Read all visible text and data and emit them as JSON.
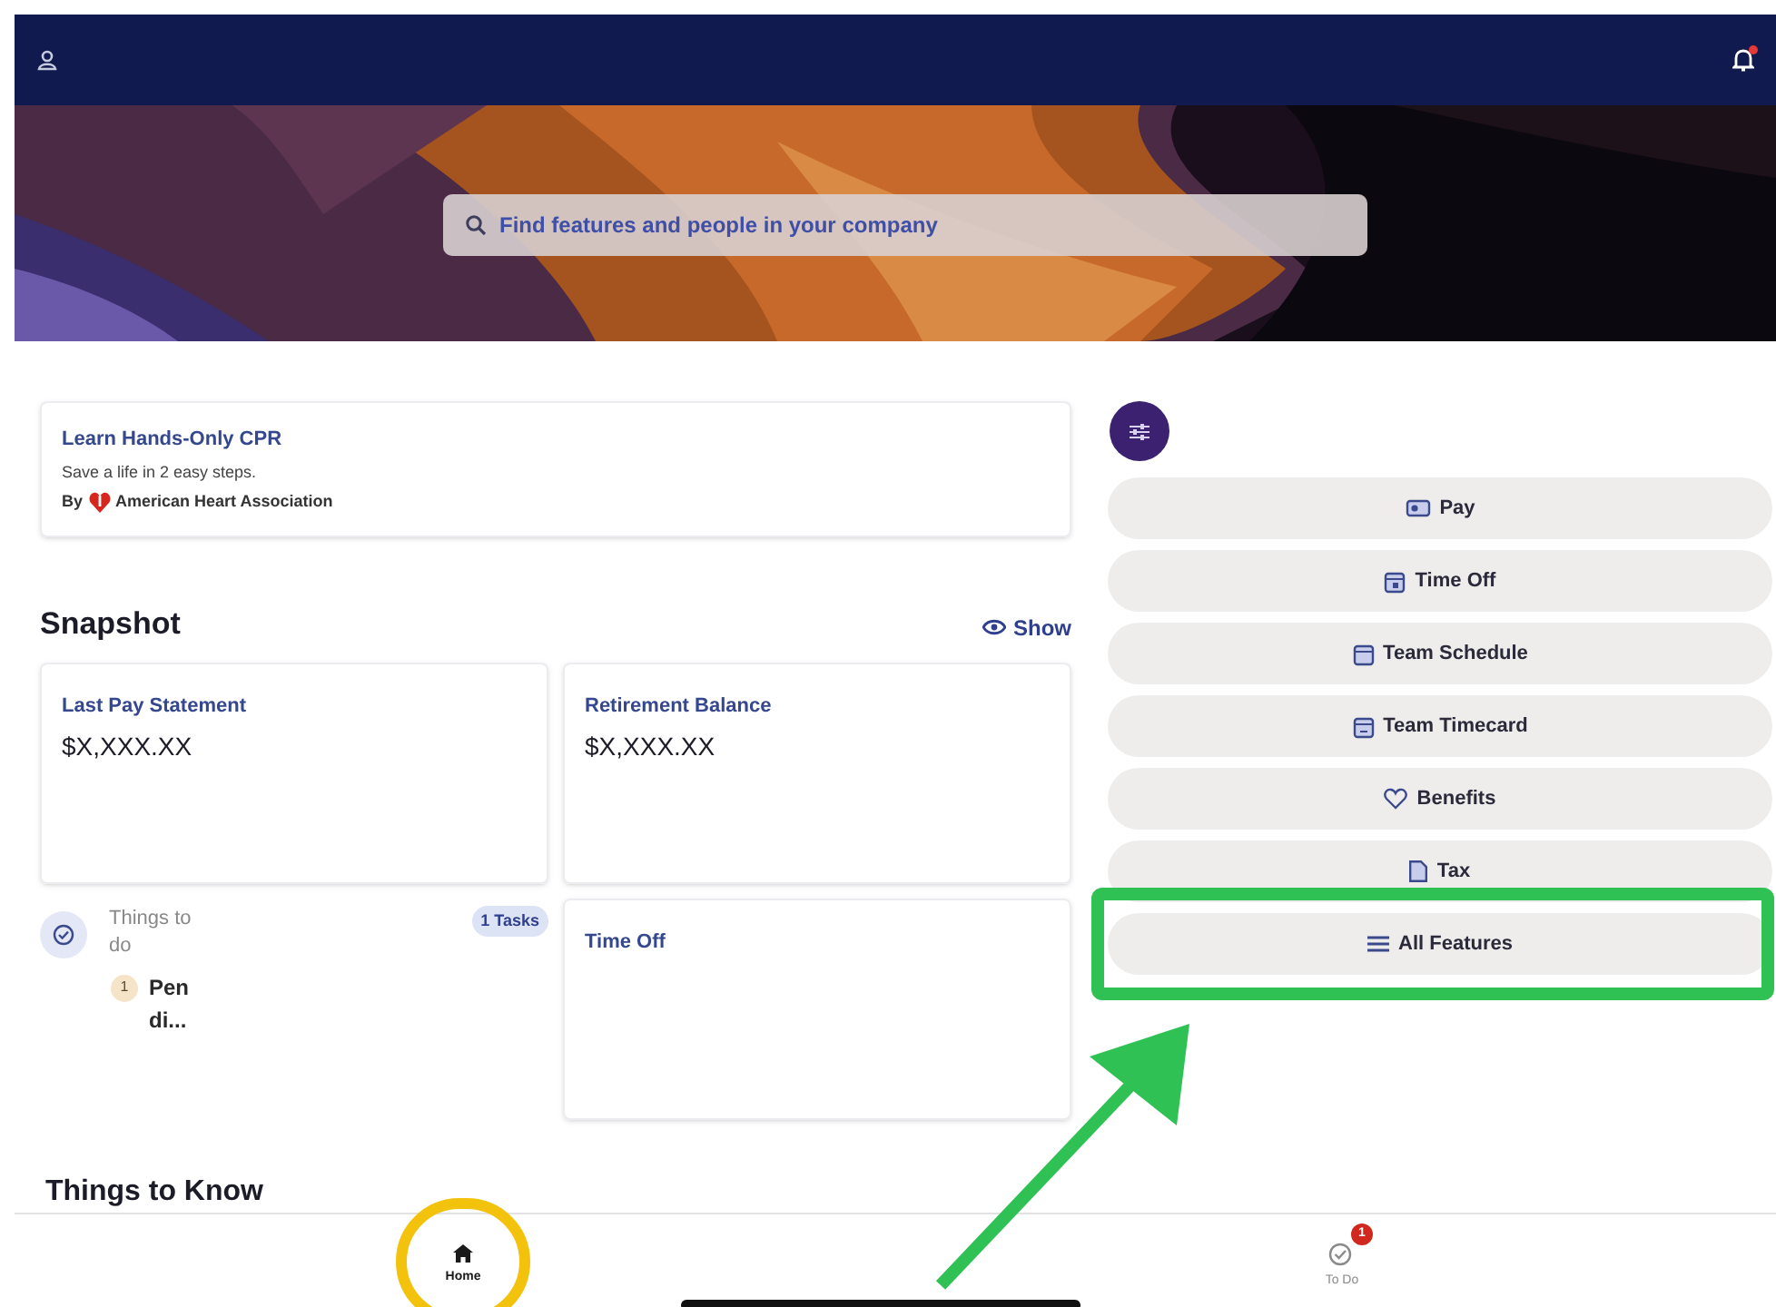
{
  "search": {
    "placeholder": "Find features and people in your company"
  },
  "notifications": {
    "unread": true
  },
  "promo": {
    "title": "Learn Hands-Only CPR",
    "subtitle": "Save a life in 2 easy steps.",
    "by": "By",
    "source": "American Heart Association"
  },
  "snapshot": {
    "title": "Snapshot",
    "toggle": "Show",
    "cards": [
      {
        "title": "Last Pay Statement",
        "value": "$X,XXX.XX"
      },
      {
        "title": "Retirement Balance",
        "value": "$X,XXX.XX"
      },
      {
        "title": "Time Off"
      }
    ]
  },
  "todo": {
    "title": "Things to do",
    "count": "1 Tasks",
    "items": [
      {
        "number": "1",
        "text": "Pen di..."
      }
    ]
  },
  "features": [
    {
      "kind": "pay",
      "label": "Pay"
    },
    {
      "kind": "timeoff",
      "label": "Time Off"
    },
    {
      "kind": "schedule",
      "label": "Team Schedule"
    },
    {
      "kind": "timecard",
      "label": "Team Timecard"
    },
    {
      "kind": "benefits",
      "label": "Benefits"
    },
    {
      "kind": "tax",
      "label": "Tax"
    },
    {
      "kind": "all",
      "label": "All Features"
    }
  ],
  "section_title": "Things to Know",
  "bottom_nav": [
    {
      "kind": "home",
      "label": "Home",
      "selected": true
    },
    {
      "kind": "todo",
      "label": "To Do",
      "selected": false,
      "badge": "1"
    }
  ]
}
